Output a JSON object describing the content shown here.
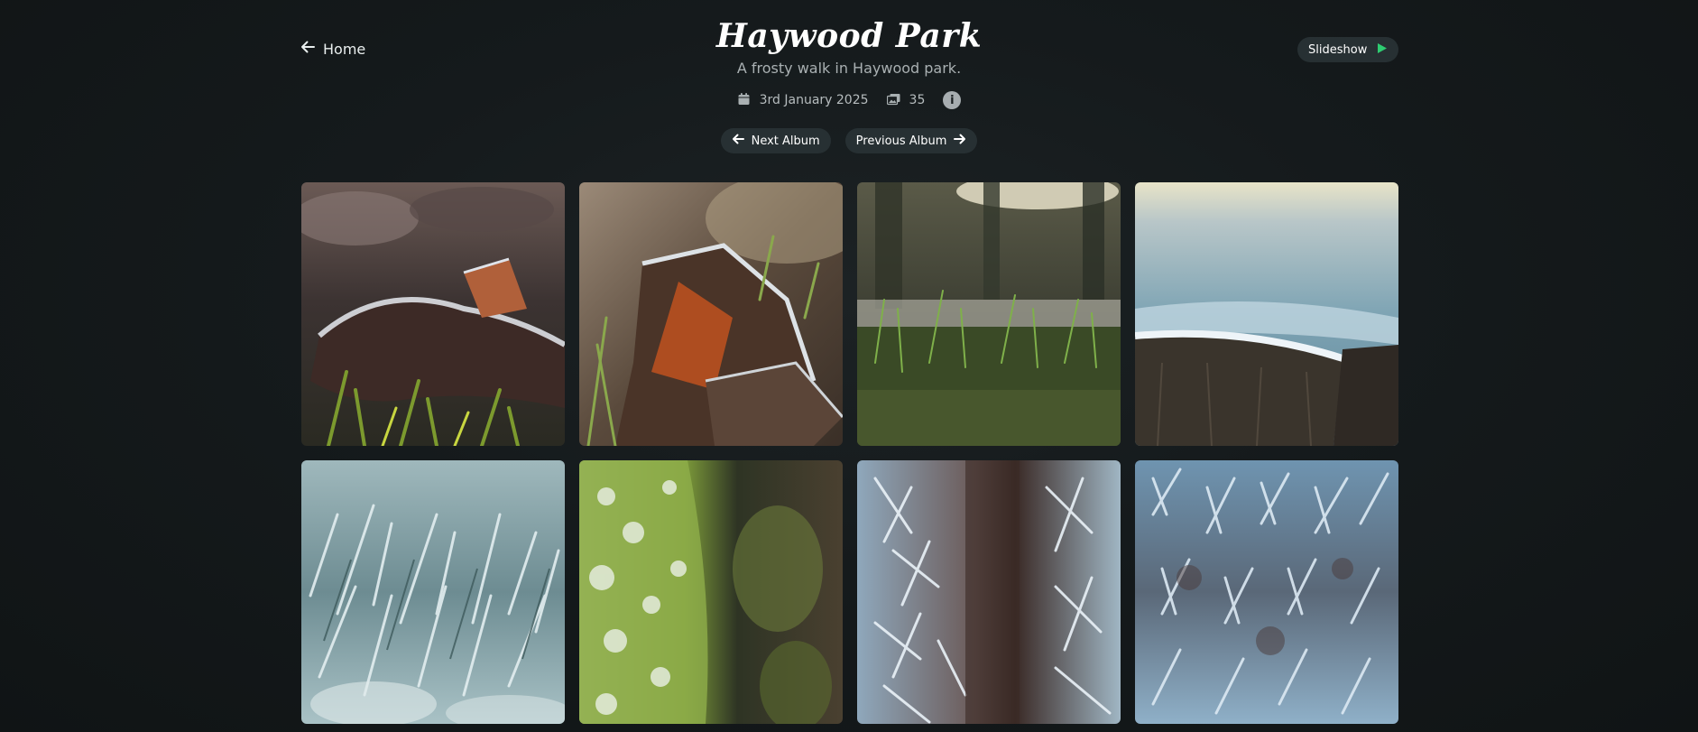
{
  "header": {
    "home_label": "Home",
    "title": "Haywood Park",
    "subtitle": "A frosty walk in Haywood park.",
    "slideshow_label": "Slideshow"
  },
  "meta": {
    "date": "3rd January 2025",
    "photo_count": "35",
    "info_label": "i"
  },
  "navigation": {
    "next_album_label": "Next Album",
    "previous_album_label": "Previous Album"
  },
  "colors": {
    "accent_green": "#2ecc71",
    "pill_background": "#273033",
    "page_background": "#151a1c"
  },
  "icons": {
    "home": "arrow-left-icon",
    "date": "calendar-icon",
    "count": "images-icon",
    "info": "info-icon",
    "next": "arrow-left-icon",
    "previous": "arrow-right-icon",
    "slideshow": "play-icon"
  },
  "photos": [
    {
      "subject": "frosted-leaves-grass"
    },
    {
      "subject": "frosted-oak-leaf"
    },
    {
      "subject": "grass-woodland-bokeh"
    },
    {
      "subject": "frosted-tree-stump"
    },
    {
      "subject": "frosted-grass-closeup"
    },
    {
      "subject": "frosted-moss"
    },
    {
      "subject": "ice-crystals-bark"
    },
    {
      "subject": "ice-crystals-macro"
    }
  ]
}
